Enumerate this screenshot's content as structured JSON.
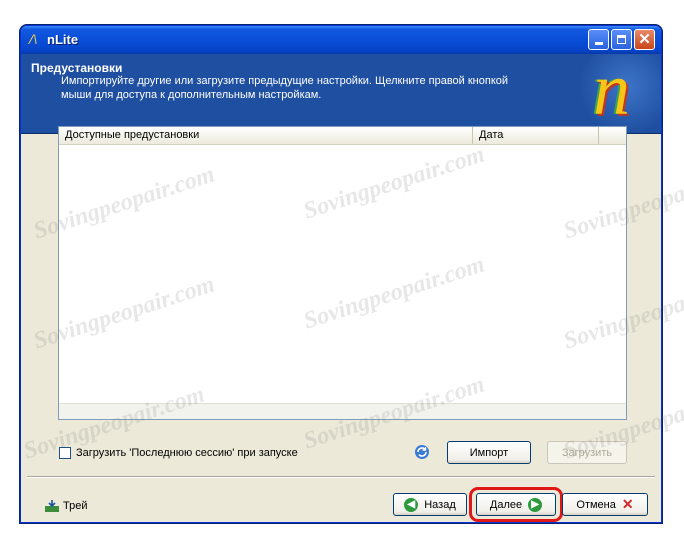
{
  "window": {
    "title": "nLite"
  },
  "banner": {
    "title": "Предустановки",
    "description": "Импортируйте другие или загрузите предыдущие настройки. Щелкните правой кнопкой мыши для доступа к дополнительным настройкам."
  },
  "list": {
    "columns": [
      "Доступные предустановки",
      "Дата"
    ],
    "rows": []
  },
  "options": {
    "load_last_session_label": "Загрузить 'Последнюю сессию' при запуске",
    "load_last_session_checked": false
  },
  "actions": {
    "import_label": "Импорт",
    "load_label": "Загрузить"
  },
  "footer": {
    "tray_label": "Трей",
    "back_label": "Назад",
    "next_label": "Далее",
    "cancel_label": "Отмена"
  },
  "watermark": "Sovingpeopair.com",
  "colors": {
    "titlebar": "#0a4ed8",
    "banner": "#1f4fa0",
    "highlight": "#e01818"
  }
}
